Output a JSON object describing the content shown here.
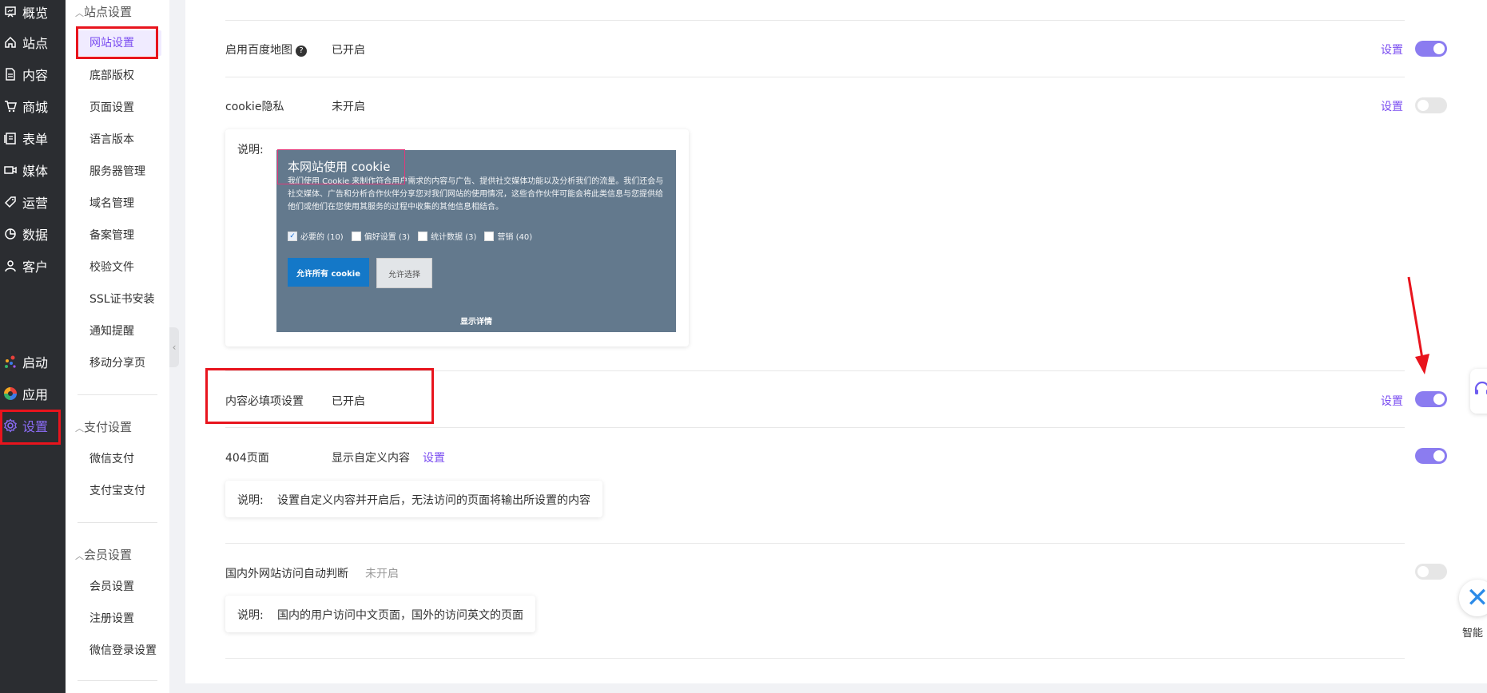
{
  "left_nav": {
    "items": [
      {
        "label": "概览",
        "icon": "presentation-icon"
      },
      {
        "label": "站点",
        "icon": "home-icon"
      },
      {
        "label": "内容",
        "icon": "document-icon"
      },
      {
        "label": "商城",
        "icon": "cart-icon"
      },
      {
        "label": "表单",
        "icon": "form-icon"
      },
      {
        "label": "媒体",
        "icon": "video-icon"
      },
      {
        "label": "运营",
        "icon": "tag-icon"
      },
      {
        "label": "数据",
        "icon": "pie-chart-icon"
      },
      {
        "label": "客户",
        "icon": "user-icon"
      }
    ],
    "bottom": [
      {
        "label": "启动",
        "icon": "launch-dots-icon"
      },
      {
        "label": "应用",
        "icon": "apps-wheel-icon"
      },
      {
        "label": "设置",
        "icon": "gear-icon"
      }
    ],
    "active_color": "#8b6cf6"
  },
  "submenu": {
    "site_settings": {
      "title": "站点设置",
      "items": [
        "网站设置",
        "底部版权",
        "页面设置",
        "语言版本",
        "服务器管理",
        "域名管理",
        "备案管理",
        "校验文件",
        "SSL证书安装",
        "通知提醒",
        "移动分享页"
      ]
    },
    "payment": {
      "title": "支付设置",
      "items": [
        "微信支付",
        "支付宝支付"
      ]
    },
    "member": {
      "title": "会员设置",
      "items": [
        "会员设置",
        "注册设置",
        "微信登录设置"
      ]
    }
  },
  "main": {
    "rows": {
      "baidu_map": {
        "label": "启用百度地图",
        "help": "?",
        "status": "已开启",
        "action": "设置",
        "enabled": true
      },
      "cookie": {
        "label": "cookie隐私",
        "status": "未开启",
        "action": "设置",
        "enabled": false
      },
      "required": {
        "label": "内容必填项设置",
        "status": "已开启",
        "action": "设置",
        "enabled": true
      },
      "page404": {
        "label": "404页面",
        "status": "显示自定义内容",
        "action": "设置",
        "enabled": true
      },
      "geo_redirect": {
        "label": "国内外网站访问自动判断",
        "status": "未开启",
        "enabled": false
      }
    },
    "cookie_note_label": "说明:",
    "cookie_preview": {
      "title": "本网站使用 cookie",
      "description": "我们使用 Cookie 来制作符合用户需求的内容与广告、提供社交媒体功能以及分析我们的流量。我们还会与社交媒体、广告和分析合作伙伴分享您对我们网站的使用情况，这些合作伙伴可能会将此类信息与您提供给他们或他们在您使用其服务的过程中收集的其他信息相结合。",
      "options": [
        {
          "label": "必要的 (10)",
          "checked": true
        },
        {
          "label": "偏好设置 (3)",
          "checked": false
        },
        {
          "label": "统计数据 (3)",
          "checked": false
        },
        {
          "label": "营销 (40)",
          "checked": false
        }
      ],
      "allow_all": "允许所有 cookie",
      "allow_selected": "允许选择",
      "show_details": "显示详情"
    },
    "page404_note": {
      "label": "说明:",
      "text": "设置自定义内容并开启后，无法访问的页面将输出所设置的内容"
    },
    "geo_note": {
      "label": "说明:",
      "text": "国内的用户访问中文页面，国外的访问英文的页面"
    }
  },
  "floating": {
    "support_icon": "headset-icon",
    "ai_icon": "close-x-icon",
    "ai_label": "智能"
  },
  "colors": {
    "accent": "#7a4cf0",
    "toggle_on": "#8b7cf0",
    "annotation_red": "#e8141d"
  }
}
